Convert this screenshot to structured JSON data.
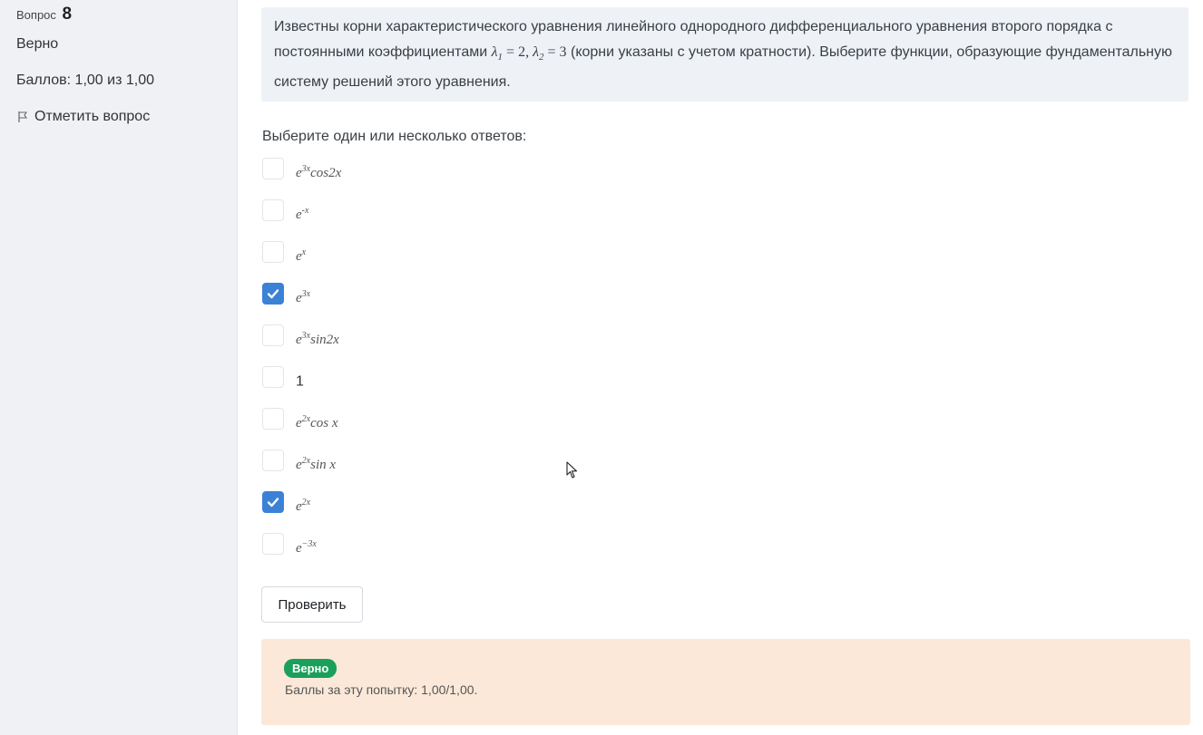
{
  "sidebar": {
    "question_word": "Вопрос",
    "question_number": "8",
    "state": "Верно",
    "grade": "Баллов: 1,00 из 1,00",
    "flag_label": "Отметить вопрос"
  },
  "question": {
    "text_part1": "Известны корни характеристического уравнения линейного однородного дифференциального уравнения второго порядка с постоянными коэффициентами ",
    "lambda1": "λ",
    "lambda1_sub": "1",
    "lambda1_eq": " = 2, ",
    "lambda2": "λ",
    "lambda2_sub": "2",
    "lambda2_eq": " = 3",
    "text_part2": " (корни указаны с учетом кратности). Выберите функции, образующие фундаментальную систему решений этого уравнения."
  },
  "answer_prompt": "Выберите один или несколько ответов:",
  "options": [
    {
      "base": "e",
      "exp": "3x",
      "tail": "cos2x",
      "checked": false
    },
    {
      "base": "e",
      "exp": "-x",
      "tail": "",
      "checked": false
    },
    {
      "base": "e",
      "exp": "x",
      "tail": "",
      "checked": false
    },
    {
      "base": "e",
      "exp": "3x",
      "tail": "",
      "checked": true
    },
    {
      "base": "e",
      "exp": "3x",
      "tail": "sin2x",
      "checked": false
    },
    {
      "base": "1",
      "exp": "",
      "tail": "",
      "checked": false
    },
    {
      "base": "e",
      "exp": "2x",
      "tail": "cos x",
      "checked": false
    },
    {
      "base": "e",
      "exp": "2x",
      "tail": "sin x",
      "checked": false
    },
    {
      "base": "e",
      "exp": "2x",
      "tail": "",
      "checked": true
    },
    {
      "base": "e",
      "exp": "−3x",
      "tail": "",
      "checked": false
    }
  ],
  "check_button": "Проверить",
  "feedback": {
    "badge": "Верно",
    "points_text": "Баллы за эту попытку: 1,00/1,00."
  },
  "colors": {
    "checkbox_checked": "#3b82d6",
    "badge_green": "#1aa05a",
    "feedback_bg": "#fbe8d8",
    "question_bg": "#eef2f7",
    "sidebar_bg": "#f0f1f5"
  },
  "icons": {
    "flag": "flag-icon",
    "check": "check-icon",
    "cursor": "mouse-pointer-icon"
  }
}
